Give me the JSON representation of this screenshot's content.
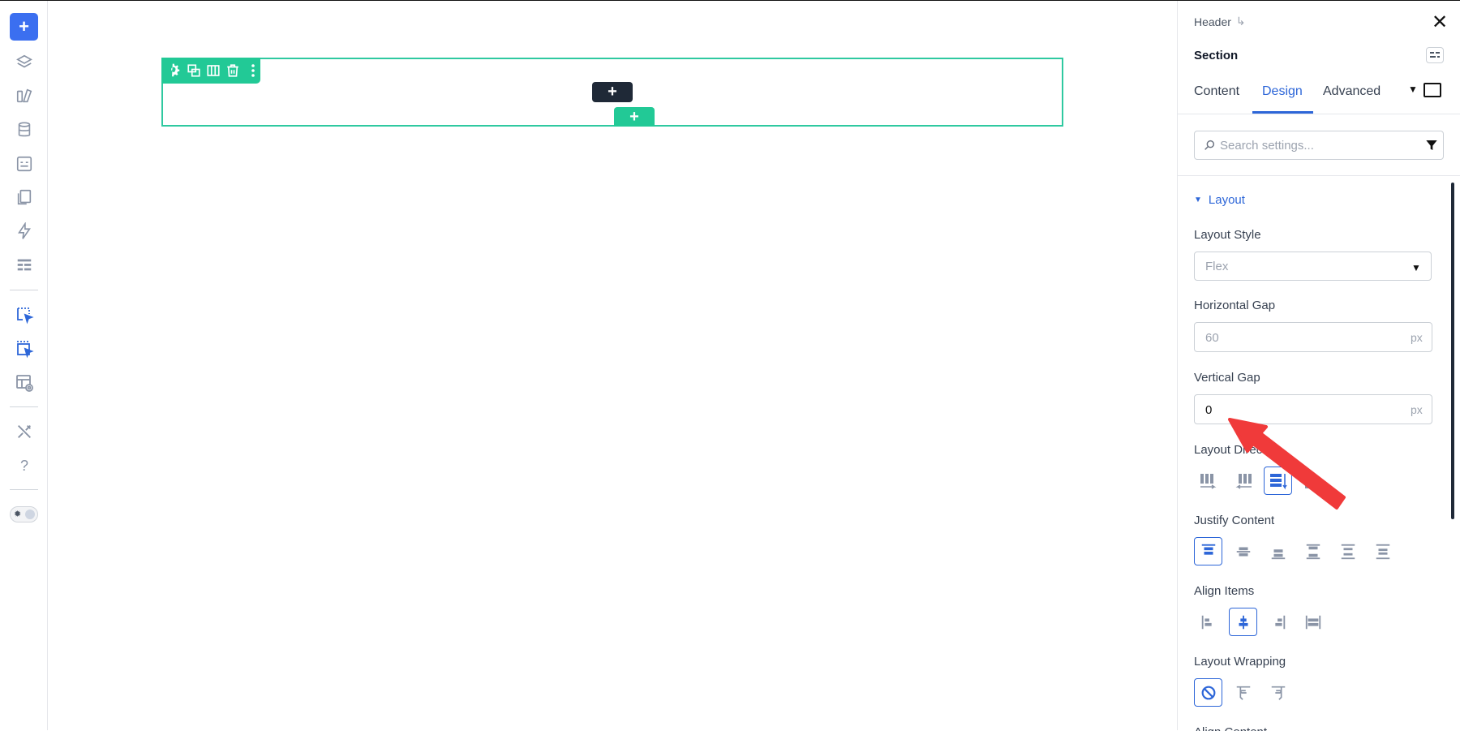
{
  "left_toolbar": {
    "items": [
      {
        "name": "add-button"
      },
      {
        "name": "layers-icon"
      },
      {
        "name": "design-library-icon"
      },
      {
        "name": "database-icon"
      },
      {
        "name": "form-icon"
      },
      {
        "name": "pages-icon"
      },
      {
        "name": "lightning-icon"
      },
      {
        "name": "layout-icon"
      },
      {
        "name": "select-element-icon"
      },
      {
        "name": "select-multiple-icon"
      },
      {
        "name": "template-preview-icon"
      },
      {
        "name": "tools-icon"
      },
      {
        "name": "help-icon"
      },
      {
        "name": "theme-toggle"
      }
    ],
    "help_label": "?"
  },
  "canvas": {
    "add_dark_label": "+",
    "add_green_label": "+",
    "section_toolbar_icons": [
      "gear-icon",
      "duplicate-icon",
      "columns-icon",
      "trash-icon",
      "more-vertical-icon"
    ]
  },
  "panel": {
    "breadcrumb": "Header",
    "breadcrumb_icon": "↳",
    "close_label": "✕",
    "title": "Section",
    "tabs": [
      {
        "label": "Content",
        "active": false
      },
      {
        "label": "Design",
        "active": true
      },
      {
        "label": "Advanced",
        "active": false
      }
    ],
    "search_placeholder": "Search settings...",
    "group_title": "Layout",
    "fields": {
      "layout_style": {
        "label": "Layout Style",
        "value": "Flex"
      },
      "horizontal_gap": {
        "label": "Horizontal Gap",
        "value": "60",
        "unit": "px"
      },
      "vertical_gap": {
        "label": "Vertical Gap",
        "value": "0",
        "unit": "px"
      },
      "layout_direction": {
        "label": "Layout Direction",
        "options": [
          "row",
          "row-reverse",
          "column",
          "column-reverse"
        ],
        "selected": "column"
      },
      "justify_content": {
        "label": "Justify Content",
        "options": [
          "start",
          "center",
          "end",
          "space-between",
          "space-around",
          "space-evenly"
        ],
        "selected": "start"
      },
      "align_items": {
        "label": "Align Items",
        "options": [
          "start",
          "center",
          "end",
          "stretch"
        ],
        "selected": "center"
      },
      "layout_wrapping": {
        "label": "Layout Wrapping",
        "options": [
          "nowrap",
          "wrap",
          "wrap-reverse"
        ],
        "selected": "nowrap"
      },
      "align_content": {
        "label": "Align Content"
      }
    }
  },
  "colors": {
    "accent_blue": "#2d66d8",
    "section_green": "#22c996",
    "annotation_red": "#f03a3a"
  }
}
